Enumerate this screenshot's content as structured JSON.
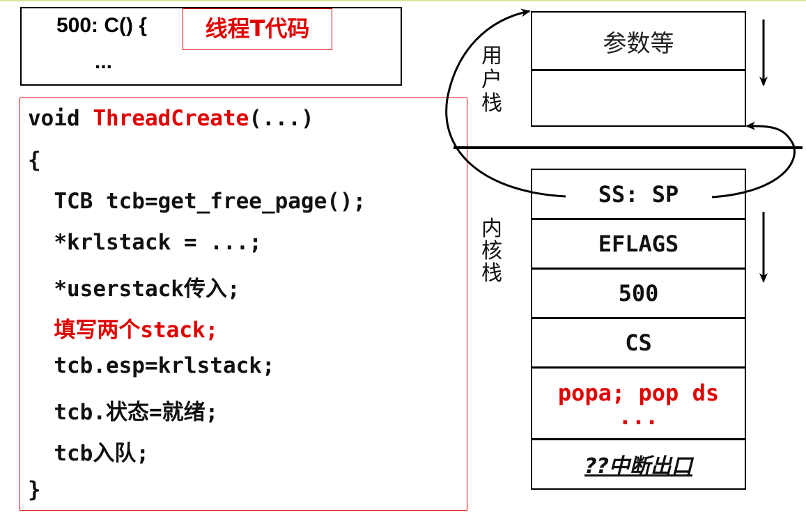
{
  "top_box": {
    "code": "500: C() {",
    "dots": "...",
    "thread_label": "线程T代码"
  },
  "code": {
    "lines": [
      {
        "prefix": "void ",
        "red": "ThreadCreate",
        "suffix": "(...)"
      },
      {
        "text": "{"
      },
      {
        "text": "  TCB tcb=get_free_page();"
      },
      {
        "text": "  *krlstack = ...;"
      },
      {
        "text": "  *userstack传入;"
      },
      {
        "red_text": "  填写两个stack;"
      },
      {
        "text": "  tcb.esp=krlstack;"
      },
      {
        "text": "  tcb.状态=就绪;"
      },
      {
        "text": "  tcb入队;"
      },
      {
        "text": "}"
      }
    ]
  },
  "user_stack": {
    "label": "用户栈",
    "cells": [
      "参数等",
      ""
    ]
  },
  "kernel_stack": {
    "label": "内核栈",
    "cells": [
      "SS: SP",
      "EFLAGS",
      "500",
      "CS"
    ],
    "red_cell": {
      "line1": "popa; pop ds",
      "line2": "..."
    },
    "exit_cell": "??中断出口"
  },
  "colors": {
    "accent_red": "#e00000",
    "border": "#000000"
  }
}
